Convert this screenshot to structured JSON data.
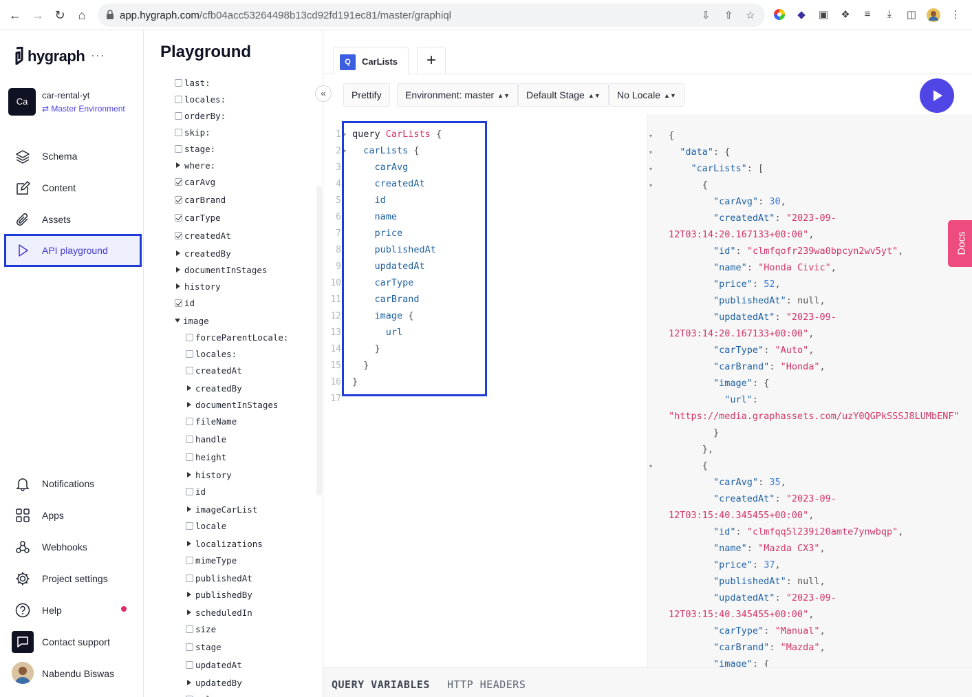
{
  "browser": {
    "url_host": "app.hygraph.com",
    "url_path": "/cfb04acc53264498b13cd92fd191ec81/master/graphiql"
  },
  "sidebar": {
    "brand": "hygraph",
    "more": "···",
    "project_badge": "Ca",
    "project_name": "car-rental-yt",
    "environment": "Master Environment",
    "nav": [
      {
        "label": "Schema",
        "icon": "layers-icon"
      },
      {
        "label": "Content",
        "icon": "edit-icon"
      },
      {
        "label": "Assets",
        "icon": "paperclip-icon"
      },
      {
        "label": "API playground",
        "icon": "play-icon",
        "active": true
      }
    ],
    "bottom_nav": [
      {
        "label": "Notifications",
        "icon": "bell-icon"
      },
      {
        "label": "Apps",
        "icon": "apps-icon"
      },
      {
        "label": "Webhooks",
        "icon": "webhooks-icon"
      },
      {
        "label": "Project settings",
        "icon": "gear-icon"
      },
      {
        "label": "Help",
        "icon": "help-icon"
      },
      {
        "label": "Contact support",
        "icon": "chat-icon"
      },
      {
        "label": "Nabendu Biswas",
        "icon": "avatar"
      }
    ]
  },
  "explorer": {
    "title": "Playground",
    "rows": [
      {
        "label": "last:",
        "kind": "checkbox",
        "checked": false,
        "indent": 0
      },
      {
        "label": "locales:",
        "kind": "checkbox",
        "checked": false,
        "indent": 0
      },
      {
        "label": "orderBy:",
        "kind": "checkbox",
        "checked": false,
        "indent": 0
      },
      {
        "label": "skip:",
        "kind": "checkbox",
        "checked": false,
        "indent": 0
      },
      {
        "label": "stage:",
        "kind": "checkbox",
        "checked": false,
        "indent": 0
      },
      {
        "label": "where:",
        "kind": "arrow",
        "indent": 0
      },
      {
        "label": "carAvg",
        "kind": "checkbox",
        "checked": true,
        "indent": 0
      },
      {
        "label": "carBrand",
        "kind": "checkbox",
        "checked": true,
        "indent": 0
      },
      {
        "label": "carType",
        "kind": "checkbox",
        "checked": true,
        "indent": 0
      },
      {
        "label": "createdAt",
        "kind": "checkbox",
        "checked": true,
        "indent": 0
      },
      {
        "label": "createdBy",
        "kind": "arrow",
        "indent": 0
      },
      {
        "label": "documentInStages",
        "kind": "arrow",
        "indent": 0
      },
      {
        "label": "history",
        "kind": "arrow",
        "indent": 0
      },
      {
        "label": "id",
        "kind": "checkbox",
        "checked": true,
        "indent": 0
      },
      {
        "label": "image",
        "kind": "arrow-open",
        "indent": 0
      },
      {
        "label": "forceParentLocale:",
        "kind": "checkbox",
        "checked": false,
        "indent": 1
      },
      {
        "label": "locales:",
        "kind": "checkbox",
        "checked": false,
        "indent": 1
      },
      {
        "label": "createdAt",
        "kind": "checkbox",
        "checked": false,
        "indent": 1
      },
      {
        "label": "createdBy",
        "kind": "arrow",
        "indent": 1
      },
      {
        "label": "documentInStages",
        "kind": "arrow",
        "indent": 1
      },
      {
        "label": "fileName",
        "kind": "checkbox",
        "checked": false,
        "indent": 1
      },
      {
        "label": "handle",
        "kind": "checkbox",
        "checked": false,
        "indent": 1
      },
      {
        "label": "height",
        "kind": "checkbox",
        "checked": false,
        "indent": 1
      },
      {
        "label": "history",
        "kind": "arrow",
        "indent": 1
      },
      {
        "label": "id",
        "kind": "checkbox",
        "checked": false,
        "indent": 1
      },
      {
        "label": "imageCarList",
        "kind": "arrow",
        "indent": 1
      },
      {
        "label": "locale",
        "kind": "checkbox",
        "checked": false,
        "indent": 1
      },
      {
        "label": "localizations",
        "kind": "arrow",
        "indent": 1
      },
      {
        "label": "mimeType",
        "kind": "checkbox",
        "checked": false,
        "indent": 1
      },
      {
        "label": "publishedAt",
        "kind": "checkbox",
        "checked": false,
        "indent": 1
      },
      {
        "label": "publishedBy",
        "kind": "arrow",
        "indent": 1
      },
      {
        "label": "scheduledIn",
        "kind": "arrow",
        "indent": 1
      },
      {
        "label": "size",
        "kind": "checkbox",
        "checked": false,
        "indent": 1
      },
      {
        "label": "stage",
        "kind": "checkbox",
        "checked": false,
        "indent": 1
      },
      {
        "label": "updatedAt",
        "kind": "checkbox",
        "checked": false,
        "indent": 1
      },
      {
        "label": "updatedBy",
        "kind": "arrow",
        "indent": 1
      },
      {
        "label": "url",
        "kind": "checkbox",
        "checked": true,
        "indent": 1
      }
    ]
  },
  "tabs": {
    "active_badge": "Q",
    "active_label": "CarLists",
    "add_label": "+"
  },
  "toolbar": {
    "prettify": "Prettify",
    "environment": "Environment: master",
    "stage": "Default Stage",
    "locale": "No Locale"
  },
  "query_lines": [
    [
      [
        "kw",
        "query "
      ],
      [
        "def",
        "CarLists"
      ],
      [
        "punc",
        " {"
      ]
    ],
    [
      [
        "fld",
        "  carLists"
      ],
      [
        "punc",
        " {"
      ]
    ],
    [
      [
        "fld",
        "    carAvg"
      ]
    ],
    [
      [
        "fld",
        "    createdAt"
      ]
    ],
    [
      [
        "fld",
        "    id"
      ]
    ],
    [
      [
        "fld",
        "    name"
      ]
    ],
    [
      [
        "fld",
        "    price"
      ]
    ],
    [
      [
        "fld",
        "    publishedAt"
      ]
    ],
    [
      [
        "fld",
        "    updatedAt"
      ]
    ],
    [
      [
        "fld",
        "    carType"
      ]
    ],
    [
      [
        "fld",
        "    carBrand"
      ]
    ],
    [
      [
        "fld",
        "    image"
      ],
      [
        "punc",
        " {"
      ]
    ],
    [
      [
        "fld",
        "      url"
      ]
    ],
    [
      [
        "punc",
        "    }"
      ]
    ],
    [
      [
        "punc",
        "  }"
      ]
    ],
    [
      [
        "punc",
        "}"
      ]
    ],
    [
      [
        "punc",
        ""
      ]
    ]
  ],
  "result_lines": [
    [
      [
        "punc",
        "{"
      ]
    ],
    [
      [
        "punc",
        "  "
      ],
      [
        "rk",
        "\"data\""
      ],
      [
        "punc",
        ": {"
      ]
    ],
    [
      [
        "punc",
        "    "
      ],
      [
        "rk",
        "\"carLists\""
      ],
      [
        "punc",
        ": ["
      ]
    ],
    [
      [
        "punc",
        "      {"
      ]
    ],
    [
      [
        "punc",
        "        "
      ],
      [
        "rk",
        "\"carAvg\""
      ],
      [
        "punc",
        ": "
      ],
      [
        "rn",
        "30"
      ],
      [
        "punc",
        ","
      ]
    ],
    [
      [
        "punc",
        "        "
      ],
      [
        "rk",
        "\"createdAt\""
      ],
      [
        "punc",
        ": "
      ],
      [
        "rs",
        "\"2023-09-"
      ]
    ],
    [
      [
        "rs",
        "12T03:14:20.167133+00:00\""
      ],
      [
        "punc",
        ","
      ]
    ],
    [
      [
        "punc",
        "        "
      ],
      [
        "rk",
        "\"id\""
      ],
      [
        "punc",
        ": "
      ],
      [
        "rs",
        "\"clmfqofr239wa0bpcyn2wv5yt\""
      ],
      [
        "punc",
        ","
      ]
    ],
    [
      [
        "punc",
        "        "
      ],
      [
        "rk",
        "\"name\""
      ],
      [
        "punc",
        ": "
      ],
      [
        "rs",
        "\"Honda Civic\""
      ],
      [
        "punc",
        ","
      ]
    ],
    [
      [
        "punc",
        "        "
      ],
      [
        "rk",
        "\"price\""
      ],
      [
        "punc",
        ": "
      ],
      [
        "rn",
        "52"
      ],
      [
        "punc",
        ","
      ]
    ],
    [
      [
        "punc",
        "        "
      ],
      [
        "rk",
        "\"publishedAt\""
      ],
      [
        "punc",
        ": null,"
      ]
    ],
    [
      [
        "punc",
        "        "
      ],
      [
        "rk",
        "\"updatedAt\""
      ],
      [
        "punc",
        ": "
      ],
      [
        "rs",
        "\"2023-09-"
      ]
    ],
    [
      [
        "rs",
        "12T03:14:20.167133+00:00\""
      ],
      [
        "punc",
        ","
      ]
    ],
    [
      [
        "punc",
        "        "
      ],
      [
        "rk",
        "\"carType\""
      ],
      [
        "punc",
        ": "
      ],
      [
        "rs",
        "\"Auto\""
      ],
      [
        "punc",
        ","
      ]
    ],
    [
      [
        "punc",
        "        "
      ],
      [
        "rk",
        "\"carBrand\""
      ],
      [
        "punc",
        ": "
      ],
      [
        "rs",
        "\"Honda\""
      ],
      [
        "punc",
        ","
      ]
    ],
    [
      [
        "punc",
        "        "
      ],
      [
        "rk",
        "\"image\""
      ],
      [
        "punc",
        ": {"
      ]
    ],
    [
      [
        "punc",
        "          "
      ],
      [
        "rk",
        "\"url\""
      ],
      [
        "punc",
        ":"
      ]
    ],
    [
      [
        "rs",
        "\"https://media.graphassets.com/uzY0QGPkSSSJ8LUMbENF\""
      ]
    ],
    [
      [
        "punc",
        "        }"
      ]
    ],
    [
      [
        "punc",
        "      },"
      ]
    ],
    [
      [
        "punc",
        "      {"
      ]
    ],
    [
      [
        "punc",
        "        "
      ],
      [
        "rk",
        "\"carAvg\""
      ],
      [
        "punc",
        ": "
      ],
      [
        "rn",
        "35"
      ],
      [
        "punc",
        ","
      ]
    ],
    [
      [
        "punc",
        "        "
      ],
      [
        "rk",
        "\"createdAt\""
      ],
      [
        "punc",
        ": "
      ],
      [
        "rs",
        "\"2023-09-"
      ]
    ],
    [
      [
        "rs",
        "12T03:15:40.345455+00:00\""
      ],
      [
        "punc",
        ","
      ]
    ],
    [
      [
        "punc",
        "        "
      ],
      [
        "rk",
        "\"id\""
      ],
      [
        "punc",
        ": "
      ],
      [
        "rs",
        "\"clmfqq5l239i20amte7ynwbqp\""
      ],
      [
        "punc",
        ","
      ]
    ],
    [
      [
        "punc",
        "        "
      ],
      [
        "rk",
        "\"name\""
      ],
      [
        "punc",
        ": "
      ],
      [
        "rs",
        "\"Mazda CX3\""
      ],
      [
        "punc",
        ","
      ]
    ],
    [
      [
        "punc",
        "        "
      ],
      [
        "rk",
        "\"price\""
      ],
      [
        "punc",
        ": "
      ],
      [
        "rn",
        "37"
      ],
      [
        "punc",
        ","
      ]
    ],
    [
      [
        "punc",
        "        "
      ],
      [
        "rk",
        "\"publishedAt\""
      ],
      [
        "punc",
        ": null,"
      ]
    ],
    [
      [
        "punc",
        "        "
      ],
      [
        "rk",
        "\"updatedAt\""
      ],
      [
        "punc",
        ": "
      ],
      [
        "rs",
        "\"2023-09-"
      ]
    ],
    [
      [
        "rs",
        "12T03:15:40.345455+00:00\""
      ],
      [
        "punc",
        ","
      ]
    ],
    [
      [
        "punc",
        "        "
      ],
      [
        "rk",
        "\"carType\""
      ],
      [
        "punc",
        ": "
      ],
      [
        "rs",
        "\"Manual\""
      ],
      [
        "punc",
        ","
      ]
    ],
    [
      [
        "punc",
        "        "
      ],
      [
        "rk",
        "\"carBrand\""
      ],
      [
        "punc",
        ": "
      ],
      [
        "rs",
        "\"Mazda\""
      ],
      [
        "punc",
        ","
      ]
    ],
    [
      [
        "punc",
        "        "
      ],
      [
        "rk",
        "\"image\""
      ],
      [
        "punc",
        ": {"
      ]
    ]
  ],
  "docs_label": "Docs",
  "bottom": {
    "query_variables": "QUERY VARIABLES",
    "http_headers": "HTTP HEADERS"
  }
}
